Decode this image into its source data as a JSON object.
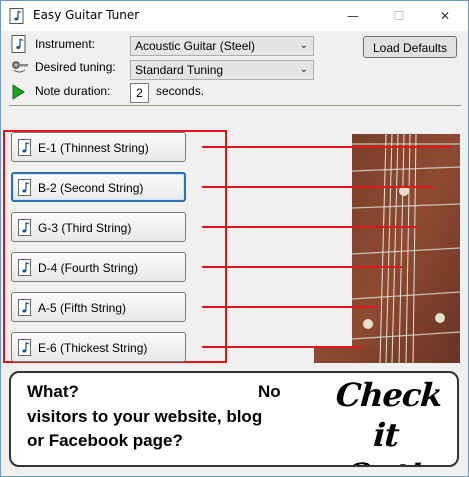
{
  "window": {
    "title": "Easy Guitar Tuner"
  },
  "controls": {
    "instrument_label": "Instrument:",
    "instrument_value": "Acoustic Guitar (Steel)",
    "tuning_label": "Desired tuning:",
    "tuning_value": "Standard Tuning",
    "duration_label": "Note duration:",
    "duration_value": "2",
    "duration_unit": "seconds.",
    "load_defaults": "Load Defaults"
  },
  "strings": [
    {
      "label": "E-1 (Thinnest String)"
    },
    {
      "label": "B-2 (Second String)"
    },
    {
      "label": "G-3 (Third String)"
    },
    {
      "label": "D-4 (Fourth String)"
    },
    {
      "label": "A-5 (Fifth String)"
    },
    {
      "label": "E-6 (Thickest String)"
    }
  ],
  "banner": {
    "line1": "What?",
    "line1b": "No",
    "line2": "visitors to your website, blog",
    "line3": "or Facebook page?",
    "cta_line1": "Check it",
    "cta_line2": "Out!"
  },
  "colors": {
    "highlight": "#e0161b",
    "focus": "#2f6fb3"
  }
}
